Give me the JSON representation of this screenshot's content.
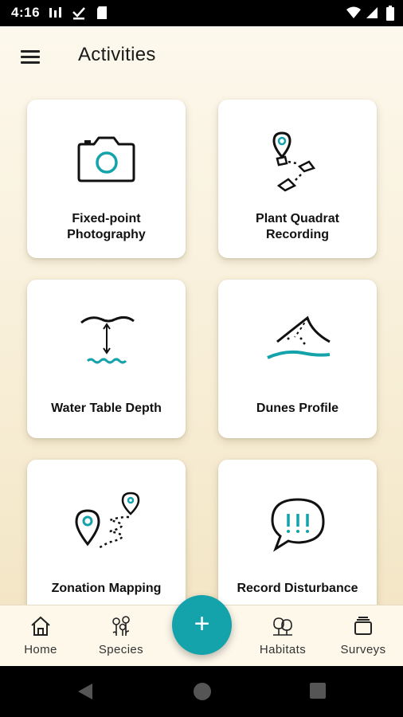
{
  "status_bar": {
    "time": "4:16"
  },
  "header": {
    "title": "Activities",
    "menu_icon": "hamburger-menu-icon"
  },
  "activities": [
    {
      "label_line1": "Fixed-point",
      "label_line2": "Photography",
      "icon": "camera-icon"
    },
    {
      "label_line1": "Plant Quadrat",
      "label_line2": "Recording",
      "icon": "quadrat-map-icon"
    },
    {
      "label": "Water Table Depth",
      "icon": "water-depth-icon"
    },
    {
      "label": "Dunes Profile",
      "icon": "dune-profile-icon"
    },
    {
      "label": "Zonation Mapping",
      "icon": "zonation-map-icon"
    },
    {
      "label": "Record Disturbance",
      "icon": "disturbance-speech-icon"
    }
  ],
  "bottom_nav": {
    "items": [
      {
        "label": "Home",
        "icon": "home-icon"
      },
      {
        "label": "Species",
        "icon": "flowers-icon"
      },
      {
        "label": "Habitats",
        "icon": "trees-icon"
      },
      {
        "label": "Surveys",
        "icon": "surveys-stack-icon"
      }
    ]
  },
  "fab": {
    "label": "+",
    "icon": "add-icon"
  },
  "colors": {
    "accent": "#14a2ab",
    "background": "#fbf4e2",
    "card": "#ffffff"
  }
}
